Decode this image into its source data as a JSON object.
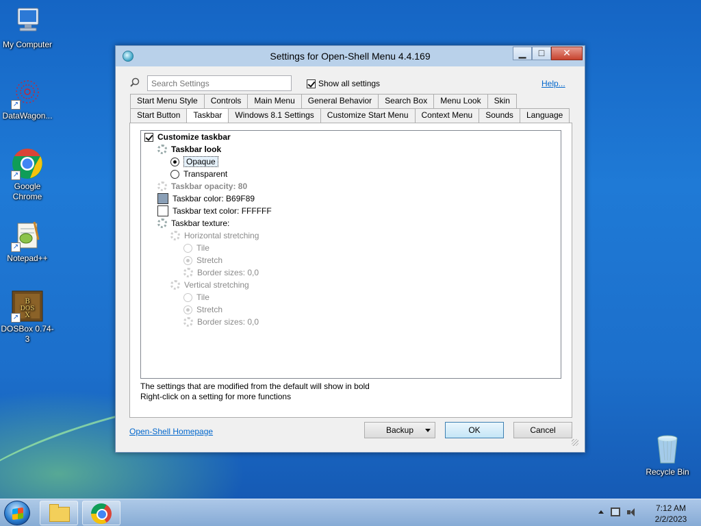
{
  "desktop": {
    "icons": [
      {
        "label": "My Computer"
      },
      {
        "label": "DataWagon..."
      },
      {
        "label": "Google Chrome"
      },
      {
        "label": "Notepad++"
      },
      {
        "label": "DOSBox 0.74-3"
      },
      {
        "label": "Recycle Bin"
      }
    ]
  },
  "window": {
    "title": "Settings for Open-Shell Menu 4.4.169",
    "search_placeholder": "Search Settings",
    "show_all_label": "Show all settings",
    "show_all_checked": true,
    "help_label": "Help...",
    "tabs_row1": [
      "Start Menu Style",
      "Controls",
      "Main Menu",
      "General Behavior",
      "Search Box",
      "Menu Look",
      "Skin"
    ],
    "tabs_row2": [
      "Start Button",
      "Taskbar",
      "Windows 8.1 Settings",
      "Customize Start Menu",
      "Context Menu",
      "Sounds",
      "Language"
    ],
    "active_tab": "Taskbar",
    "tree": {
      "customize_taskbar": "Customize taskbar",
      "taskbar_look": "Taskbar look",
      "opaque": "Opaque",
      "transparent": "Transparent",
      "taskbar_opacity": "Taskbar opacity: 80",
      "taskbar_color": "Taskbar color: B69F89",
      "taskbar_color_hex": "#8a9fb6",
      "taskbar_text_color": "Taskbar text color: FFFFFF",
      "taskbar_text_color_hex": "#ffffff",
      "taskbar_texture": "Taskbar texture:",
      "horizontal_stretching": "Horizontal stretching",
      "h_tile": "Tile",
      "h_stretch": "Stretch",
      "h_border": "Border sizes: 0,0",
      "vertical_stretching": "Vertical stretching",
      "v_tile": "Tile",
      "v_stretch": "Stretch",
      "v_border": "Border sizes: 0,0"
    },
    "hint_line1": "The settings that are modified from the default will show in bold",
    "hint_line2": "Right-click on a setting for more functions",
    "homepage_label": "Open-Shell Homepage",
    "backup_label": "Backup",
    "ok_label": "OK",
    "cancel_label": "Cancel"
  },
  "taskbar": {
    "time": "7:12 AM",
    "date": "2/2/2023"
  }
}
